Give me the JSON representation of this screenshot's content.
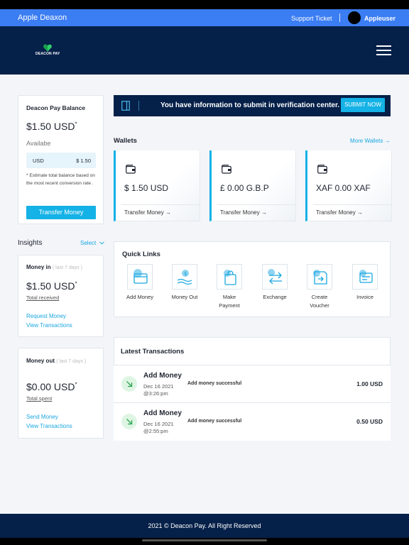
{
  "topbar": {
    "brand": "Apple Deaxon",
    "support": "Support Ticket",
    "user": "Appleuser"
  },
  "logo": {
    "text": "DEACON PAY"
  },
  "balance_card": {
    "title": "Deacon Pay Balance",
    "amount": "$1.50 USD",
    "asterisk": "*",
    "available_label": "Availabe",
    "currency": "USD",
    "currency_amount": "$ 1.50",
    "note": "* Estimate total balance based on the most recent conversion rate .",
    "button": "Transfer Money"
  },
  "insights": {
    "label": "Insights",
    "select": "Select",
    "money_in": {
      "title": "Money in",
      "period": "( last 7 days )",
      "amount": "$1.50 USD",
      "asterisk": "*",
      "sub": "Total received",
      "link1": "Request Money",
      "link2": "View Transactions"
    },
    "money_out": {
      "title": "Money out",
      "period": "( last 7 days )",
      "amount": "$0.00 USD",
      "asterisk": "*",
      "sub": "Total spent",
      "link1": "Send Money",
      "link2": "View Transactions"
    }
  },
  "banner": {
    "text": "You have information to submit in verification center.",
    "button": "SUBMIT NOW"
  },
  "wallets": {
    "title": "Wallets",
    "more": "More Wallets",
    "arrow": "→",
    "items": [
      {
        "amount": "$ 1.50 USD",
        "action": "Transfer Money",
        "arrow": "→"
      },
      {
        "amount": "£ 0.00 G.B.P",
        "action": "Transfer Money",
        "arrow": "→"
      },
      {
        "amount": "XAF 0.00 XAF",
        "action": "Transfer Money",
        "arrow": "→"
      }
    ]
  },
  "quick_links": {
    "title": "Quick Links",
    "items": [
      {
        "label": "Add Money",
        "icon": "add-money-icon"
      },
      {
        "label": "Money Out",
        "icon": "money-out-icon"
      },
      {
        "label": "Make Payment",
        "icon": "payment-bag-icon"
      },
      {
        "label": "Exchange",
        "icon": "exchange-icon"
      },
      {
        "label": "Create Voucher",
        "icon": "voucher-icon"
      },
      {
        "label": "Invoice",
        "icon": "invoice-icon"
      }
    ]
  },
  "transactions": {
    "title": "Latest Transactions",
    "rows": [
      {
        "type": "Add Money",
        "date": "Dec 16 2021",
        "time": "@3:26:pm",
        "status": "Add money successful",
        "amount": "1.00 USD"
      },
      {
        "type": "Add Money",
        "date": "Dec 16 2021",
        "time": "@2:55:pm",
        "status": "Add money successful",
        "amount": "0.50 USD"
      }
    ]
  },
  "footer": {
    "text": "2021 © Deacon Pay. All Right Reserved"
  },
  "colors": {
    "accent": "#14b2e6",
    "navy": "#052049",
    "topbar": "#3b7df2",
    "success_bg": "#dff5e4"
  }
}
